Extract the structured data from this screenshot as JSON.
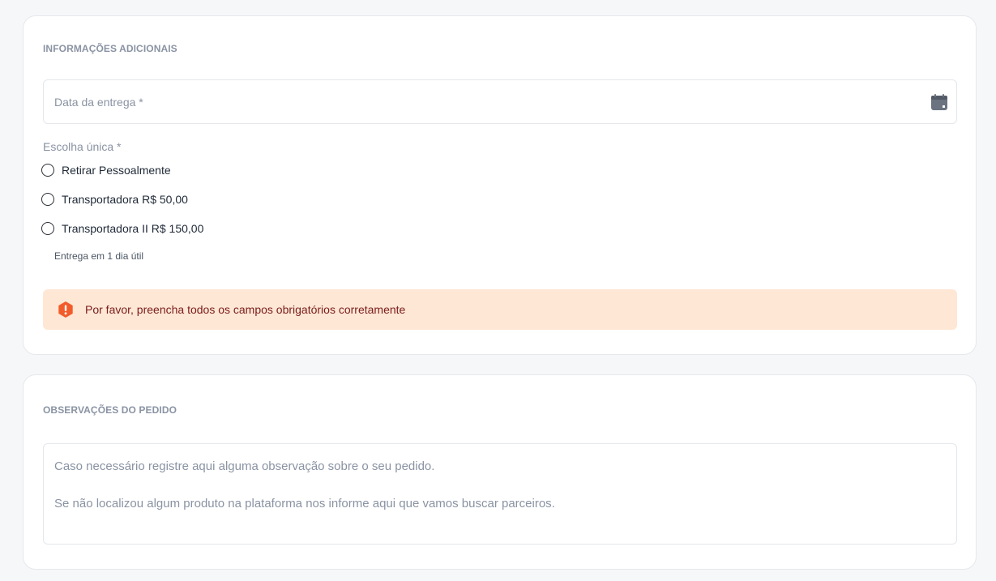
{
  "additional_info": {
    "title": "INFORMAÇÕES ADICIONAIS",
    "date_field": {
      "label": "Data da entrega *",
      "value": "",
      "icon": "calendar-icon"
    },
    "choice": {
      "label": "Escolha única *",
      "options": [
        {
          "label": "Retirar Pessoalmente",
          "selected": false
        },
        {
          "label": "Transportadora R$ 50,00",
          "selected": false
        },
        {
          "label": "Transportadora II R$ 150,00",
          "selected": false
        }
      ],
      "helper": "Entrega em 1 dia útil"
    },
    "alert": {
      "icon": "exclamation-shield-icon",
      "message": "Por favor, preencha todos os campos obrigatórios corretamente",
      "background": "#fee7d5",
      "icon_color": "#f25c2b"
    }
  },
  "order_notes": {
    "title": "OBSERVAÇÕES DO PEDIDO",
    "placeholder_lines": [
      "Caso necessário registre aqui alguma observação sobre o seu pedido.",
      "Se não localizou algum produto na plataforma nos informe aqui que vamos buscar parceiros."
    ]
  }
}
